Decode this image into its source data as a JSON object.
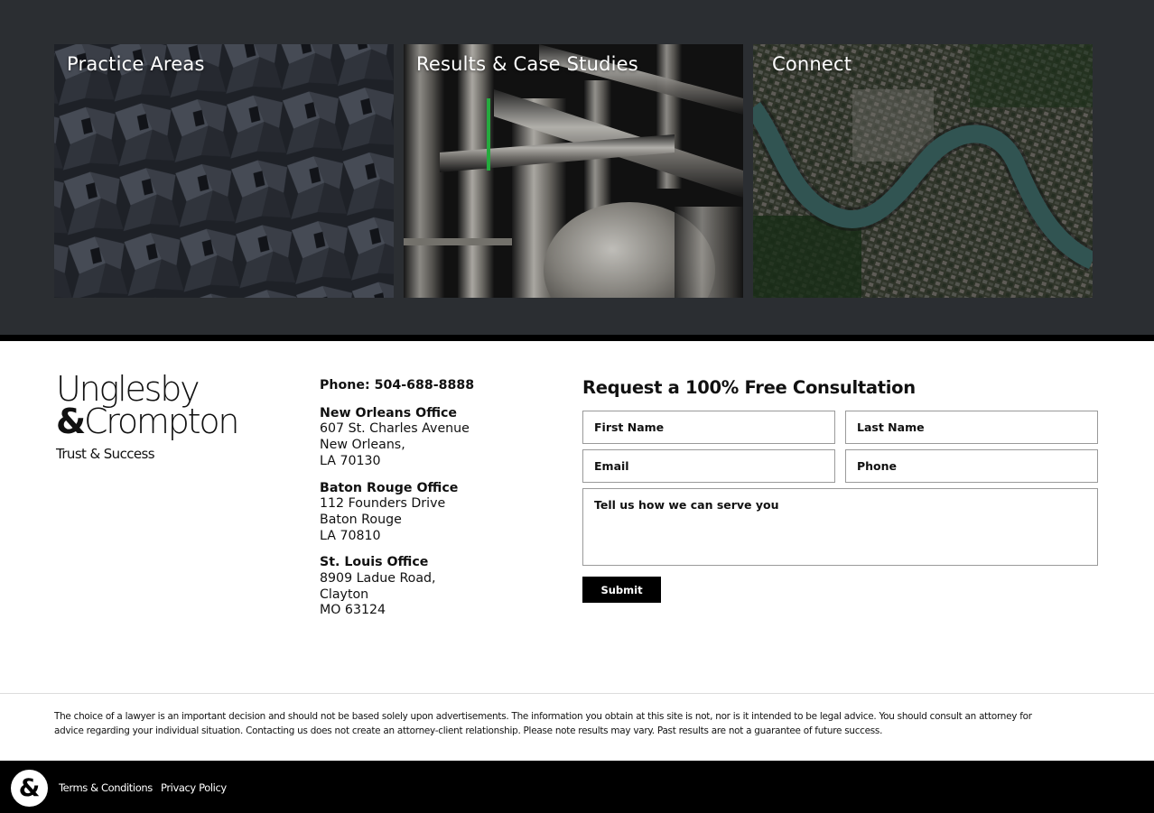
{
  "tiles": [
    {
      "title": "Practice Areas"
    },
    {
      "title": "Results & Case Studies"
    },
    {
      "title": "Connect"
    }
  ],
  "brand": {
    "name_line1": "Unglesby",
    "amp": "&",
    "name_line2": "Crompton",
    "tagline": "Trust & Success",
    "badge_glyph": "&"
  },
  "contact": {
    "phone": "Phone: 504-688-8888",
    "offices": [
      {
        "name": "New Orleans Office",
        "line1": "607 St. Charles Avenue",
        "line2": "New Orleans,",
        "line3": "LA 70130"
      },
      {
        "name": "Baton Rouge Office",
        "line1": "112 Founders Drive",
        "line2": "Baton Rouge",
        "line3": "LA 70810"
      },
      {
        "name": "St. Louis Office",
        "line1": "8909 Ladue Road,",
        "line2": "Clayton",
        "line3": "MO 63124"
      }
    ]
  },
  "form": {
    "title": "Request a 100% Free Consultation",
    "first_name_placeholder": "First Name",
    "last_name_placeholder": "Last Name",
    "email_placeholder": "Email",
    "phone_placeholder": "Phone",
    "message_placeholder": "Tell us how we can serve you",
    "submit_label": "Submit"
  },
  "disclaimer": "The choice of a lawyer is an important decision and should not be based solely upon advertisements. The information you obtain at this site is not, nor is it intended to be legal advice. You should consult an attorney for advice regarding your individual situation. Contacting us does not create an attorney-client relationship. Please note results may vary. Past results are not a guarantee of future success.",
  "footer_links": {
    "terms": "Terms & Conditions",
    "privacy": "Privacy Policy"
  },
  "colors": {
    "band": "#2b2e32",
    "footer_bar": "#000000",
    "submit_bg": "#000000"
  }
}
